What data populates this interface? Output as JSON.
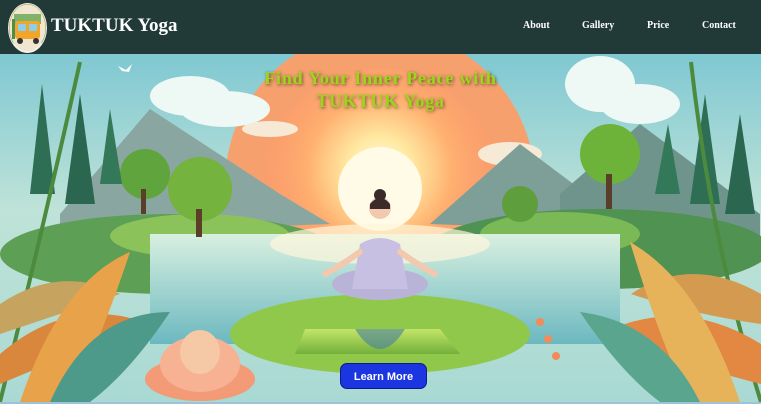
{
  "header": {
    "brand_name": "TUKTUK Yoga",
    "logo_icon": "tuktuk-logo-icon",
    "nav_items": [
      {
        "label": "About"
      },
      {
        "label": "Gallery"
      },
      {
        "label": "Price"
      },
      {
        "label": "Contact"
      }
    ],
    "background_color": "#213a38"
  },
  "hero": {
    "headline_line1": "Find Your Inner Peace with",
    "headline_line2": "TUKTUK Yoga",
    "headline_color": "#9cd61a",
    "cta_label": "Learn More",
    "cta_color": "#1b36e0",
    "illustration": "meditating-woman-lake-sunrise-illustration"
  }
}
